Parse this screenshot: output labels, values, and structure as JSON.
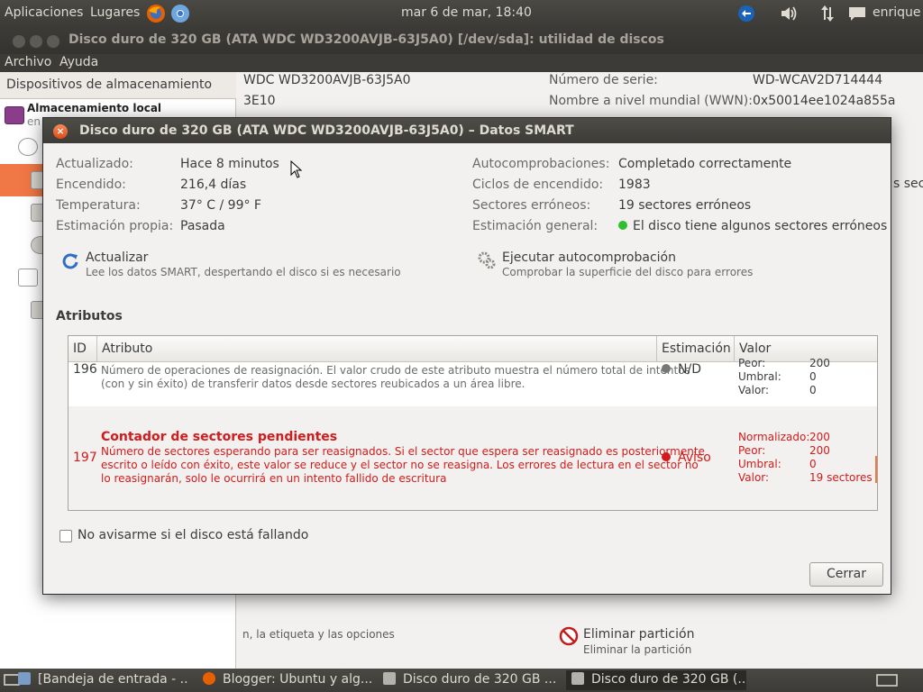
{
  "top_panel": {
    "applications": "Aplicaciones",
    "places": "Lugares",
    "clock": "mar  6 de mar, 18:40",
    "user": "enrique"
  },
  "main_window": {
    "title": "Disco duro de 320 GB (ATA WDC WD3200AVJB-63J5A0) [/dev/sda]: utilidad de discos",
    "menu": {
      "file": "Archivo",
      "help": "Ayuda"
    },
    "sidebar": {
      "header": "Dispositivos de almacenamiento",
      "section_title": "Almacenamiento local",
      "section_sub": "en"
    },
    "info": {
      "model_partial": "WDC WD3200AVJB-63J5A0",
      "firmware_partial": "3E10",
      "serial_label": "Número de serie:",
      "serial_value": "WD-WCAV2D714444",
      "wwn_label": "Nombre a nivel mundial (WWN):",
      "wwn_value": "0x50014ee1024a855a",
      "right_cut": "s sec"
    },
    "bottom": {
      "left_text": "n, la etiqueta y las opciones",
      "delete_title": "Eliminar partición",
      "delete_sub": "Eliminar la partición"
    }
  },
  "dialog": {
    "title": "Disco duro de 320 GB (ATA WDC WD3200AVJB-63J5A0) – Datos SMART",
    "fields": {
      "updated_label": "Actualizado:",
      "updated_value": "Hace 8 minutos",
      "poweron_label": "Encendido:",
      "poweron_value": "216,4 días",
      "temp_label": "Temperatura:",
      "temp_value": "37° C / 99° F",
      "selfassess_label": "Estimación propia:",
      "selfassess_value": "Pasada",
      "selftests_label": "Autocomprobaciones:",
      "selftests_value": "Completado correctamente",
      "cycles_label": "Ciclos de encendido:",
      "cycles_value": "1983",
      "bad_label": "Sectores erróneos:",
      "bad_value": "19 sectores erróneos",
      "overall_label": "Estimación general:",
      "overall_value": "El disco tiene algunos sectores erróneos"
    },
    "actions": {
      "refresh_title": "Actualizar",
      "refresh_sub": "Lee los datos SMART, despertando el disco si es necesario",
      "selftest_title": "Ejecutar autocomprobación",
      "selftest_sub": "Comprobar la superficie del disco para errores"
    },
    "attributes_heading": "Atributos",
    "table": {
      "headers": {
        "id": "ID",
        "attribute": "Atributo",
        "assessment": "Estimación",
        "value": "Valor"
      },
      "rows": [
        {
          "id": "196",
          "description_line1": "Número de operaciones de reasignación. El valor crudo de este atributo muestra el número total de intentos",
          "description_line2": "(con y sin éxito) de transferir datos desde sectores reubicados a un área libre.",
          "assessment": "N/D",
          "kv": [
            {
              "k": "Peor:",
              "v": "200"
            },
            {
              "k": "Umbral:",
              "v": "0"
            },
            {
              "k": "Valor:",
              "v": "0"
            }
          ]
        },
        {
          "id": "197",
          "name": "Contador de sectores pendientes",
          "description_line1": "Número de sectores esperando para ser reasignados. Si el sector que espera ser reasignado es posteriormente",
          "description_line2": "escrito o leído con éxito, este valor se reduce y el sector no se reasigna. Los errores de lectura en el sector no",
          "description_line3": "lo reasignarán, solo le ocurrirá en un intento fallido de escritura",
          "assessment": "Aviso",
          "kv": [
            {
              "k": "Normalizado:",
              "v": "200"
            },
            {
              "k": "Peor:",
              "v": "200"
            },
            {
              "k": "Umbral:",
              "v": "0"
            },
            {
              "k": "Valor:",
              "v": "19 sectores"
            }
          ]
        }
      ]
    },
    "dont_warn_label": "No avisarme si el disco está fallando",
    "close_button": "Cerrar"
  },
  "taskbar": {
    "tasks": [
      "[Bandeja de entrada - ...",
      "Blogger: Ubuntu y alg...",
      "Disco duro de 320 GB ...",
      "Disco duro de 320 GB (..."
    ]
  },
  "colors": {
    "accent": "#f07746",
    "warning": "#d21b1b",
    "ok": "#2fbf2f"
  }
}
